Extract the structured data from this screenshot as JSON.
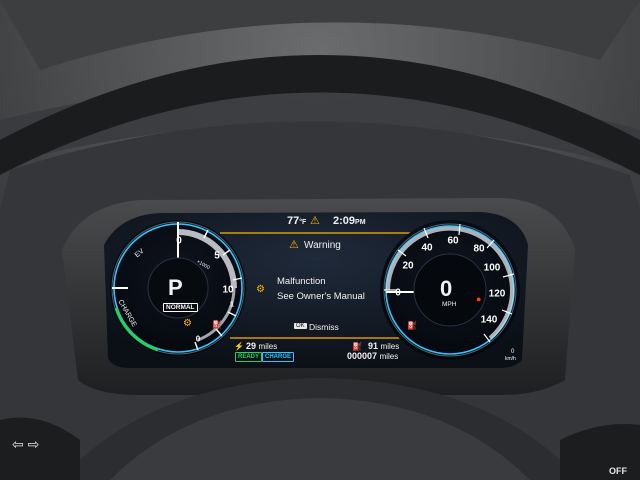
{
  "header": {
    "temperature": "77",
    "temperature_unit": "°F",
    "time": "2:09",
    "time_suffix": "PM"
  },
  "warning": {
    "title": "Warning",
    "line1": "Malfunction",
    "line2": "See Owner's Manual",
    "ok_label": "OK",
    "dismiss_label": "Dismiss"
  },
  "power_gauge": {
    "gear": "P",
    "mode": "NORMAL",
    "zone_ev": "EV",
    "zone_charge": "CHARGE",
    "unit": "×1000",
    "ticks": [
      "0",
      "5",
      "10",
      "1",
      "0"
    ]
  },
  "speedometer": {
    "speed": "0",
    "unit": "MPH",
    "ticks": [
      "0",
      "20",
      "40",
      "60",
      "80",
      "100",
      "120",
      "140"
    ],
    "sub_unit": "km/h",
    "sub_zero": "0"
  },
  "range": {
    "ev_miles_value": "29",
    "ev_miles_unit": "miles",
    "ready_label": "READY",
    "charge_label": "CHARGE",
    "total_miles_value": "91",
    "total_miles_unit": "miles",
    "odometer_value": "000007",
    "odometer_unit": "miles"
  },
  "controls": {
    "left_switch_arrows": "⇦ ⇨",
    "right_switch_label": "OFF"
  },
  "colors": {
    "accent_blue": "#34c3ff",
    "warning_amber": "#ffb300",
    "ready_green": "#26d060",
    "red_indicator": "#ff3b1f"
  }
}
